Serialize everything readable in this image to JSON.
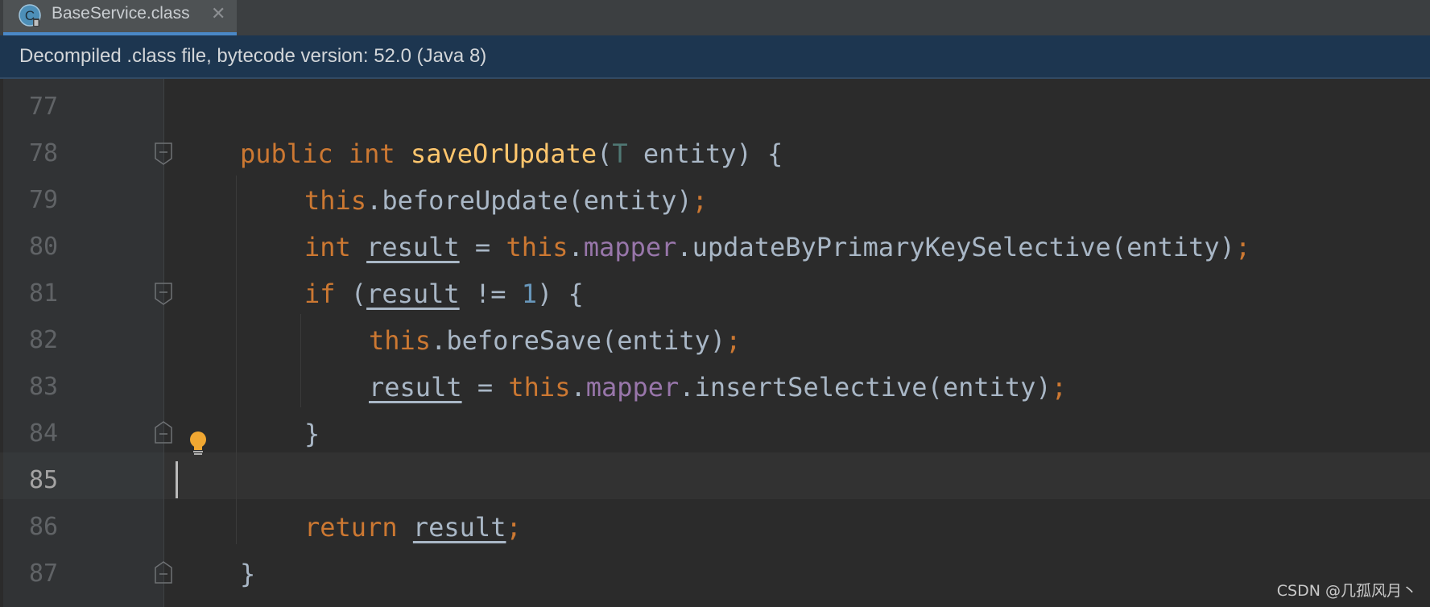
{
  "tab": {
    "label": "BaseService.class",
    "close_glyph": "✕",
    "icon": "class-file-icon"
  },
  "banner": {
    "text": "Decompiled .class file, bytecode version: 52.0 (Java 8)"
  },
  "lines": {
    "l77": "77",
    "l78": "78",
    "l79": "79",
    "l80": "80",
    "l81": "81",
    "l82": "82",
    "l83": "83",
    "l84": "84",
    "l85": "85",
    "l86": "86",
    "l87": "87"
  },
  "code": {
    "public": "public",
    "int": "int",
    "method": "saveOrUpdate",
    "open_paren": "(",
    "type_param": "T",
    "param": " entity) {",
    "this": "this",
    "before_update": ".beforeUpdate(entity)",
    "semi": ";",
    "int2": "int",
    "result": "result",
    "eq": " = ",
    "mapper": "mapper",
    "dot": ".",
    "update_call": ".updateByPrimaryKeySelective(entity)",
    "if": "if",
    "if_open": " (",
    "neq": " != ",
    "one": "1",
    "if_close": ") {",
    "before_save": ".beforeSave(entity)",
    "insert_call": ".insertSelective(entity)",
    "close_brace": "}",
    "return": "return",
    "space": " "
  },
  "colors": {
    "background": "#2b2b2b",
    "keyword": "#cc7832",
    "method": "#ffc66d",
    "field": "#9876aa",
    "number": "#6897bb",
    "text": "#a9b7c6"
  },
  "watermark": "CSDN @几孤风月丶"
}
